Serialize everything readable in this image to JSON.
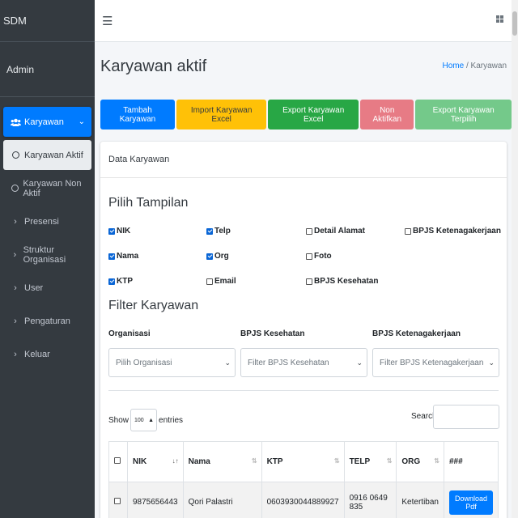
{
  "sidebar": {
    "brand": "SDM",
    "user": "Admin",
    "items": [
      {
        "label": "Karyawan",
        "icon": "users-icon"
      },
      {
        "label": "Karyawan Aktif",
        "icon": "circle-icon"
      },
      {
        "label": "Karyawan Non Aktif",
        "icon": "circle-icon"
      },
      {
        "label": "Presensi",
        "icon": "chevron-right-icon"
      },
      {
        "label": "Struktur Organisasi",
        "icon": "chevron-right-icon"
      },
      {
        "label": "User",
        "icon": "chevron-right-icon"
      },
      {
        "label": "Pengaturan",
        "icon": "chevron-right-icon"
      },
      {
        "label": "Keluar",
        "icon": "chevron-right-icon"
      }
    ]
  },
  "page": {
    "title": "Karyawan aktif",
    "breadcrumb_home": "Home",
    "breadcrumb_sep": "/",
    "breadcrumb_current": "Karyawan"
  },
  "actions": {
    "tambah": "Tambah Karyawan",
    "import": "Import Karyawan Excel",
    "export": "Export Karyawan Excel",
    "nonaktif": "Non Aktifkan",
    "export_terpilih": "Export Karyawan Terpilih"
  },
  "card": {
    "header": "Data Karyawan",
    "pilih_tampilan": "Pilih Tampilan",
    "filter_title": "Filter Karyawan"
  },
  "columns_toggle": [
    {
      "label": "NIK",
      "checked": true
    },
    {
      "label": "Telp",
      "checked": true
    },
    {
      "label": "Detail Alamat",
      "checked": false
    },
    {
      "label": "BPJS Ketenagakerjaan",
      "checked": false
    },
    {
      "label": "Nama",
      "checked": true
    },
    {
      "label": "Org",
      "checked": true
    },
    {
      "label": "Foto",
      "checked": false
    },
    {
      "label": "KTP",
      "checked": true
    },
    {
      "label": "Email",
      "checked": false
    },
    {
      "label": "BPJS Kesehatan",
      "checked": false
    }
  ],
  "filters": {
    "org_label": "Organisasi",
    "org_placeholder": "Pilih Organisasi",
    "bpjs_kes_label": "BPJS Kesehatan",
    "bpjs_kes_placeholder": "Filter BPJS Kesehatan",
    "bpjs_tk_label": "BPJS Ketenagakerjaan",
    "bpjs_tk_placeholder": "Filter BPJS Ketenagakerjaan"
  },
  "table_controls": {
    "show": "Show",
    "length": "100",
    "entries": "entries",
    "search": "Search:"
  },
  "table": {
    "headers": [
      "NIK",
      "Nama",
      "KTP",
      "TELP",
      "ORG",
      "###"
    ],
    "rows": [
      {
        "nik": "9875656443",
        "nama": "Qori Palastri",
        "ktp": "0603930044889927",
        "telp": "0916 0649 835",
        "org": "Ketertiban",
        "action": "Download Pdf"
      }
    ]
  }
}
